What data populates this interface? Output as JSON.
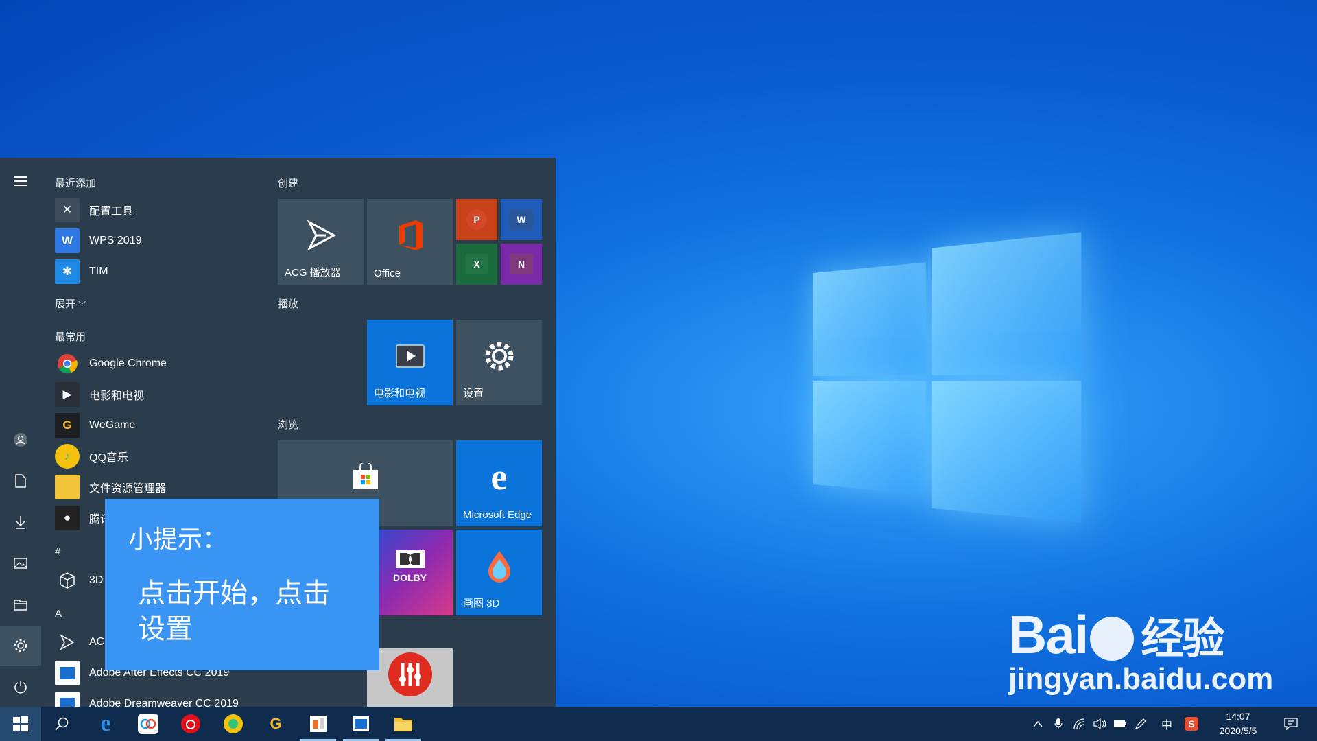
{
  "start_menu": {
    "sections": {
      "recent": "最近添加",
      "expand": "展开",
      "frequent": "最常用",
      "hash": "#",
      "letter_a": "A"
    },
    "recent_apps": [
      {
        "label": "配置工具",
        "icon": "tools-icon"
      },
      {
        "label": "WPS 2019",
        "icon": "wps-icon"
      },
      {
        "label": "TIM",
        "icon": "tim-icon"
      }
    ],
    "frequent_apps": [
      {
        "label": "Google Chrome",
        "icon": "chrome-icon"
      },
      {
        "label": "电影和电视",
        "icon": "movies-icon"
      },
      {
        "label": "WeGame",
        "icon": "wegame-icon"
      },
      {
        "label": "QQ音乐",
        "icon": "qqmusic-icon"
      },
      {
        "label": "文件资源管理器",
        "icon": "folder-icon"
      },
      {
        "label": "腾讯",
        "icon": "qq-icon"
      }
    ],
    "hash_apps": [
      {
        "label": "3D",
        "icon": "cube-icon"
      }
    ],
    "a_apps": [
      {
        "label": "ACG",
        "icon": "acg-icon"
      },
      {
        "label": "Adobe After Effects CC 2019",
        "icon": "adobe-ae-icon"
      },
      {
        "label": "Adobe Dreamweaver CC 2019",
        "icon": "adobe-dw-icon"
      }
    ],
    "tile_groups": {
      "create": "创建",
      "play": "播放",
      "browse": "浏览"
    },
    "tiles": {
      "acg": "ACG 播放器",
      "office": "Office",
      "movies": "电影和电视",
      "settings": "设置",
      "edge": "Microsoft Edge",
      "paint3d": "画图 3D",
      "dolby": "DOLBY"
    },
    "mini_tiles": {
      "powerpoint": "P",
      "word": "W",
      "excel": "X",
      "onenote": "N"
    }
  },
  "tip": {
    "title": "小提示：",
    "body": "点击开始，点击设置"
  },
  "taskbar": {
    "time": "14:07",
    "date": "2020/5/5",
    "ime": "中",
    "sogou": "S"
  },
  "watermark": {
    "logo_latin": "Bai",
    "logo_cn": "经验",
    "url": "jingyan.baidu.com"
  },
  "colors": {
    "start_bg": "#2b3d4c",
    "tile_bg": "#3e5160",
    "tile_blue": "#0a74da",
    "tip_bg": "#3a94f4",
    "taskbar_bg": "#0f2b4e"
  }
}
